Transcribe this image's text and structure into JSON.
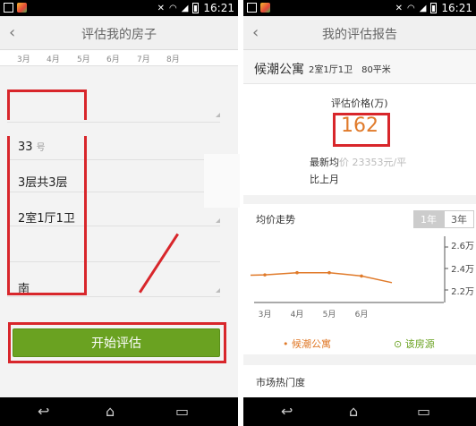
{
  "status": {
    "time": "16:21"
  },
  "left": {
    "nav": {
      "back": "‹",
      "title": "评估我的房子"
    },
    "months": [
      "3月",
      "4月",
      "5月",
      "6月",
      "7月",
      "8月"
    ],
    "fields": {
      "number": "33",
      "number_suffix": "号",
      "floors": "3层共3层",
      "rooms": "2室1厅1卫",
      "direction": "南"
    },
    "start_button": "开始评估"
  },
  "right": {
    "nav": {
      "back": "‹",
      "title": "我的评估报告"
    },
    "estate": {
      "name": "候潮公寓",
      "info": "2室1厅1卫　80平米"
    },
    "price": {
      "label": "评估价格(万)",
      "value": "162",
      "latest_prefix": "最新均",
      "latest_faded": "价 23353元/平",
      "compare": "比上月"
    },
    "trend": {
      "title": "均价走势",
      "tabs": [
        "1年",
        "3年"
      ],
      "yticks": [
        "2.6万",
        "2.4万",
        "2.2万"
      ]
    },
    "legend": {
      "estate": "• 候潮公寓",
      "house": "⊙ 该房源"
    },
    "market": {
      "title": "市场热门度"
    }
  },
  "chart_data": {
    "type": "line",
    "x": [
      "3月",
      "4月",
      "5月",
      "6月"
    ],
    "series": [
      {
        "name": "候潮公寓",
        "values": [
          2.35,
          2.37,
          2.37,
          2.34
        ]
      }
    ],
    "ylim": [
      2.1,
      2.7
    ],
    "yticks": [
      "2.6万",
      "2.4万",
      "2.2万"
    ],
    "grid": false
  },
  "colors": {
    "accent_orange": "#e07a2a",
    "button_green": "#6aa221",
    "annotation_red": "#d8262b"
  }
}
